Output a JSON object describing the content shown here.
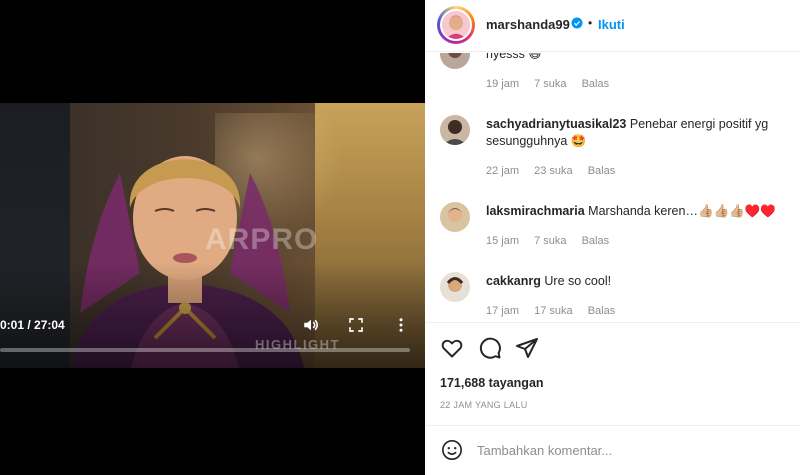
{
  "video": {
    "time": "0:01 / 27:04",
    "progress": 0.0,
    "watermark_logo": "ARPRO",
    "watermark_tag": "HIGHLIGHT"
  },
  "post": {
    "username": "marshanda99",
    "separator": "•",
    "follow_label": "Ikuti",
    "views": "171,688 tayangan",
    "posted": "22 JAM YANG LALU"
  },
  "comments": [
    {
      "user": "",
      "text": "nyesss 😆",
      "time": "19 jam",
      "likes": "7 suka",
      "reply": "Balas"
    },
    {
      "user": "sachyadrianytuasikal23",
      "text": "Penebar energi positif yg sesungguhnya 🤩",
      "time": "22 jam",
      "likes": "23 suka",
      "reply": "Balas"
    },
    {
      "user": "laksmirachmaria",
      "text": "Marshanda keren…👍🏼👍🏼👍🏼♥️♥️",
      "time": "15 jam",
      "likes": "7 suka",
      "reply": "Balas"
    },
    {
      "user": "cakkanrg",
      "text": "Ure so cool!",
      "time": "17 jam",
      "likes": "17 suka",
      "reply": "Balas"
    }
  ],
  "add_comment": {
    "placeholder": "Tambahkan komentar..."
  },
  "icons": {
    "volume": "volume-icon",
    "fullscreen": "fullscreen-icon",
    "more": "more-options-icon",
    "like": "heart-icon",
    "comment": "comment-icon",
    "share": "share-icon",
    "emoji": "emoji-icon",
    "verified": "verified-badge-icon"
  },
  "colors": {
    "accent": "#0095f6",
    "verified": "#0095f6",
    "muted": "#8e8e8e",
    "text": "#262626"
  }
}
